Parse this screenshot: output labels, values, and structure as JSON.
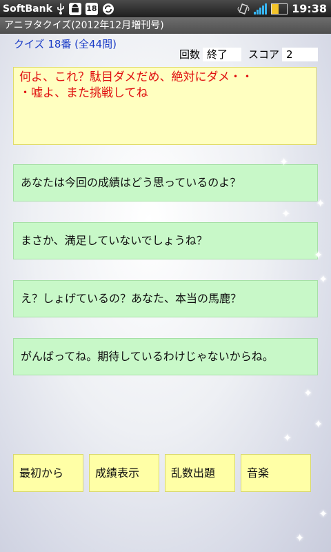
{
  "status_bar": {
    "carrier": "SoftBank",
    "time": "19:38",
    "icons": [
      "usb-icon",
      "android-icon",
      "notification-18-icon",
      "sync-icon",
      "vibrate-icon",
      "signal-icon",
      "battery-icon"
    ],
    "badge": "18"
  },
  "title_bar": {
    "title": "アニヲタクイズ(2012年12月増刊号)"
  },
  "quiz": {
    "number_label": "クイズ 18番 (全44問)",
    "round_label": "回数",
    "round_value": "終了",
    "score_label": "スコア",
    "score_value": "2",
    "question_lines": [
      "何よ、これ？駄目ダメだめ、絶対にダメ・・",
      "・嘘よ、また挑戦してね"
    ]
  },
  "answers": [
    "あなたは今回の成績はどう思っているのよ？",
    "まさか、満足していないでしょうね？",
    "え？しょげているの？あなた、本当の馬鹿？",
    "がんばってね。期待しているわけじゃないからね。"
  ],
  "buttons": {
    "restart": "最初から",
    "show_results": "成績表示",
    "random": "乱数出題",
    "music": "音楽"
  },
  "colors": {
    "question_text": "#e01010",
    "quiz_number": "#1a3cc7",
    "question_bg": "#ffffc0",
    "answer_bg": "#c8f8c8",
    "button_bg": "#ffffa6"
  }
}
